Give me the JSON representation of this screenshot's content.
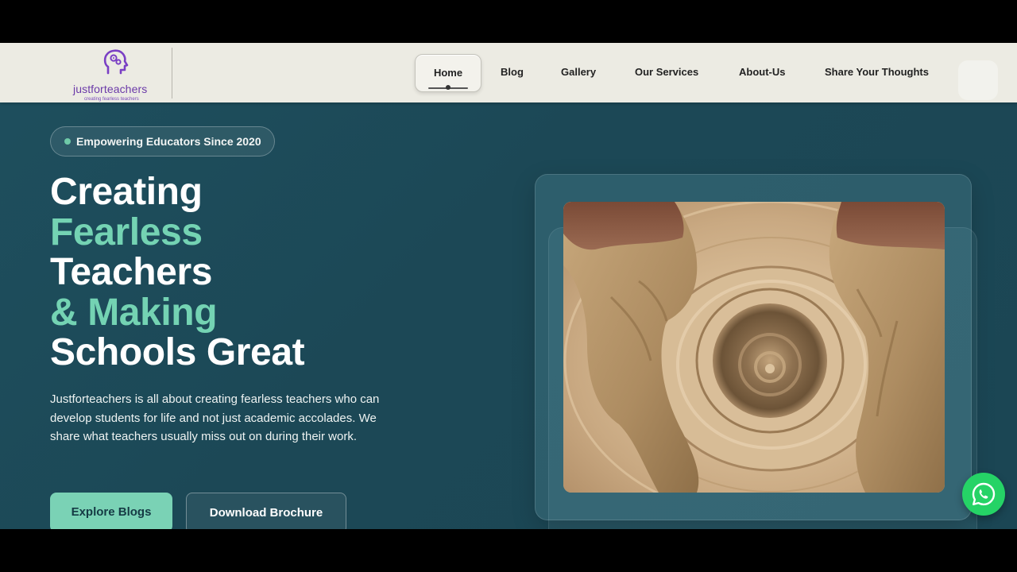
{
  "logo": {
    "name": "justforteachers",
    "tagline": "creating fearless teachers",
    "icon": "head-gears-icon"
  },
  "nav": {
    "items": [
      {
        "label": "Home",
        "active": true
      },
      {
        "label": "Blog"
      },
      {
        "label": "Gallery"
      },
      {
        "label": "Our Services"
      },
      {
        "label": "About-Us"
      },
      {
        "label": "Share Your Thoughts"
      }
    ]
  },
  "hero": {
    "badge": "Empowering Educators Since 2020",
    "headline": {
      "line1": "Creating",
      "line2": "Fearless",
      "line3": "Teachers",
      "line4": "& Making",
      "line5": "Schools Great"
    },
    "description": "Justforteachers is all about creating fearless teachers who can develop students for life and not just academic accolades. We share what teachers usually miss out on during their work.",
    "primary_button": "Explore Blogs",
    "secondary_button": "Download Brochure"
  },
  "image": {
    "subject": "pottery-wheel-clay-hands-image"
  },
  "floating": {
    "icon": "whatsapp-icon"
  },
  "colors": {
    "nav_bg": "#ecebe3",
    "hero_bg": "#1d4a58",
    "accent": "#74d3b3",
    "brand": "#6b3aa8",
    "whatsapp": "#25d366"
  }
}
